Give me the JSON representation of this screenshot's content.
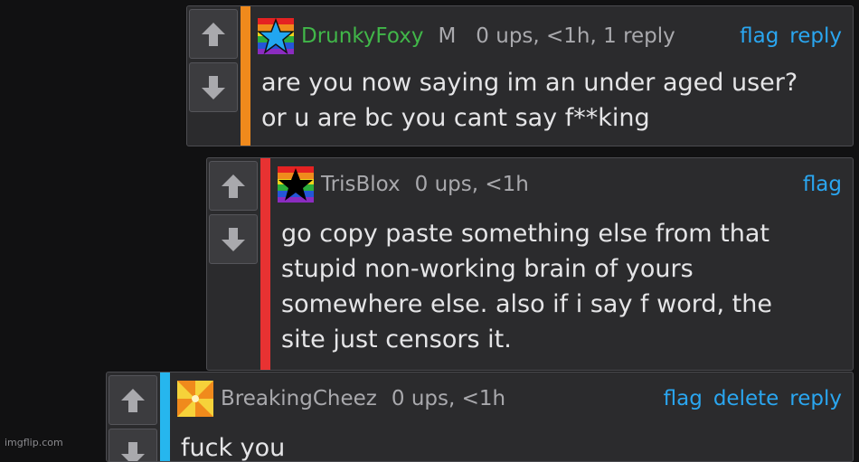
{
  "comments": [
    {
      "username": "DrunkyFoxy",
      "username_color": "#41b749",
      "badge": "M",
      "meta": "0 ups, <1h, 1 reply",
      "actions": [
        "flag",
        "reply"
      ],
      "text": [
        "are you now saying im an under aged user?",
        "or u are bc you cant say f**king"
      ],
      "bar_color": "#f08a1c",
      "avatar_icon": "rainbow-blue-star-icon"
    },
    {
      "username": "TrisBlox",
      "username_color": "#a9a9ad",
      "meta": "0 ups, <1h",
      "actions": [
        "flag"
      ],
      "text": [
        "go copy paste something else from that",
        "stupid non-working brain of yours",
        "somewhere else. also if i say f word, the",
        "site just censors it."
      ],
      "bar_color": "#e83232",
      "avatar_icon": "rainbow-black-star-icon"
    },
    {
      "username": "BreakingCheez",
      "username_color": "#a9a9ad",
      "meta": "0 ups, <1h",
      "actions": [
        "flag",
        "delete",
        "reply"
      ],
      "text": [
        "fuck you"
      ],
      "bar_color": "#26b6ee",
      "avatar_icon": "orange-pinwheel-icon"
    }
  ],
  "upvote_icon": "up-arrow-icon",
  "downvote_icon": "down-arrow-icon",
  "watermark": "imgflip.com"
}
